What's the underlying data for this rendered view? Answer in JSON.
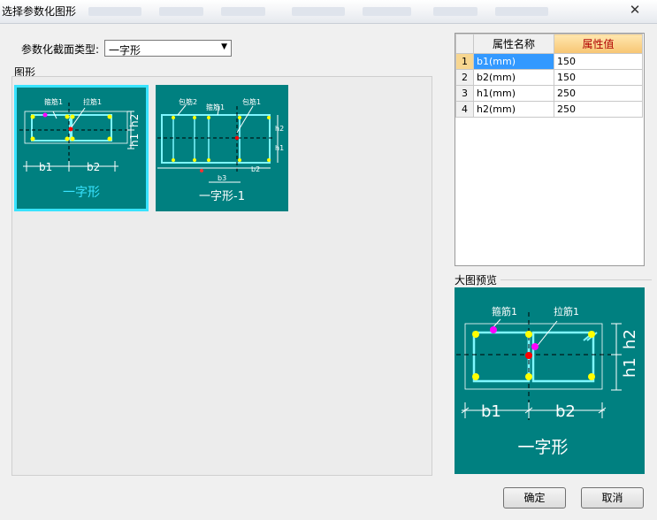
{
  "window": {
    "title": "选择参数化图形",
    "close_glyph": "✕"
  },
  "type_selector": {
    "label": "参数化截面类型:",
    "value": "一字形"
  },
  "gallery": {
    "label": "图形",
    "shapes": [
      {
        "caption": "一字形",
        "tags": [
          "箍筋1",
          "拉筋1"
        ],
        "dims": [
          "b1",
          "b2",
          "h1",
          "h2"
        ]
      },
      {
        "caption": "一字形-1",
        "tags": [
          "包筋2",
          "箍筋1",
          "包筋1"
        ],
        "dims": [
          "b3",
          "b2",
          "h2",
          "h1"
        ]
      }
    ]
  },
  "properties": {
    "headers": [
      "属性名称",
      "属性值"
    ],
    "rows": [
      {
        "n": "1",
        "name": "b1(mm)",
        "value": "150"
      },
      {
        "n": "2",
        "name": "b2(mm)",
        "value": "150"
      },
      {
        "n": "3",
        "name": "h1(mm)",
        "value": "250"
      },
      {
        "n": "4",
        "name": "h2(mm)",
        "value": "250"
      }
    ]
  },
  "preview": {
    "label": "大图预览",
    "tags": [
      "箍筋1",
      "拉筋1"
    ],
    "dims": [
      "b1",
      "b2",
      "h1",
      "h2"
    ],
    "caption": "一字形"
  },
  "buttons": {
    "ok": "确定",
    "cancel": "取消"
  },
  "colors": {
    "figure_bg": "#008080",
    "selection": "#39e3ff",
    "steel": "#7ff7ff",
    "rebar": "#ffff00",
    "tie": "#ff00ff",
    "center": "#ff0000"
  }
}
